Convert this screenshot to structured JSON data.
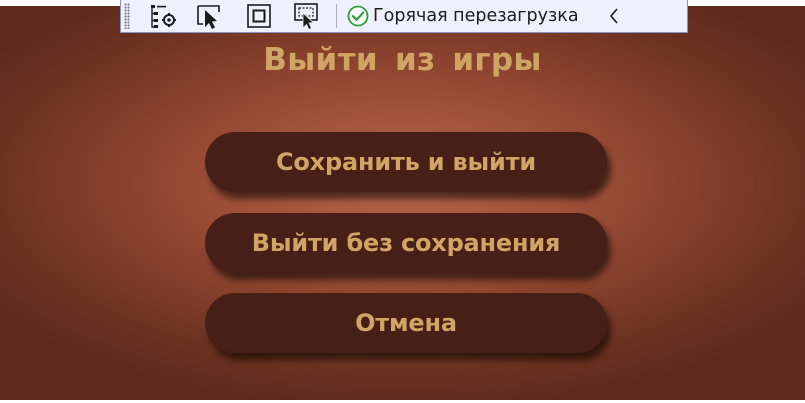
{
  "toolbar": {
    "icons": [
      "tree-settings-icon",
      "select-element-icon",
      "display-layout-adorners-icon",
      "track-focused-element-icon"
    ],
    "hot_reload_label": "Горячая перезагрузка",
    "status_color": "#2e9e3e"
  },
  "dialog": {
    "title": "Выйти  из  игры",
    "buttons": {
      "save_and_exit": "Сохранить и выйти",
      "exit_without_saving": "Выйти без сохранения",
      "cancel": "Отмена"
    }
  },
  "colors": {
    "text_gold": "#d0a464",
    "button_bg": "#471f16",
    "background_center": "#b8644c",
    "background_edge": "#5f2b1c"
  }
}
